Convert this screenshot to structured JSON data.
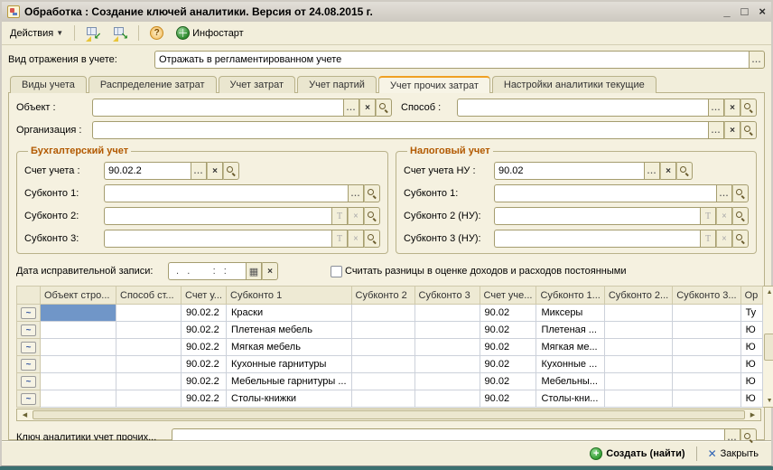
{
  "window": {
    "title": "Обработка : Создание ключей аналитики. Версия от 24.08.2015 г.",
    "controls": {
      "minimize": "_",
      "maximize": "□",
      "close": "×"
    }
  },
  "toolbar": {
    "actions": "Действия",
    "help": "?",
    "infostart": "Инфостарт"
  },
  "reflection": {
    "label": "Вид отражения в учете:",
    "value": "Отражать в регламентированном учете"
  },
  "tabs": [
    {
      "label": "Виды учета",
      "active": false
    },
    {
      "label": "Распределение затрат",
      "active": false
    },
    {
      "label": "Учет затрат",
      "active": false
    },
    {
      "label": "Учет партий",
      "active": false
    },
    {
      "label": "Учет прочих затрат",
      "active": true
    },
    {
      "label": "Настройки аналитики текущие",
      "active": false
    }
  ],
  "fields": {
    "object": {
      "label": "Объект :",
      "value": ""
    },
    "sposob": {
      "label": "Способ :",
      "value": ""
    },
    "organization": {
      "label": "Организация :",
      "value": ""
    }
  },
  "accounting_group": {
    "title": "Бухгалтерский учет",
    "account": {
      "label": "Счет учета :",
      "value": "90.02.2"
    },
    "sub1": {
      "label": "Субконто 1:",
      "value": ""
    },
    "sub2": {
      "label": "Субконто 2:",
      "value": ""
    },
    "sub3": {
      "label": "Субконто 3:",
      "value": ""
    }
  },
  "tax_group": {
    "title": "Налоговый учет",
    "account": {
      "label": "Счет учета НУ :",
      "value": "90.02"
    },
    "sub1": {
      "label": "Субконто 1:",
      "value": ""
    },
    "sub2": {
      "label": "Субконто 2 (НУ):",
      "value": ""
    },
    "sub3": {
      "label": "Субконто 3 (НУ):",
      "value": ""
    }
  },
  "correction": {
    "date_label": "Дата исправительной записи:",
    "date_value": " .  .      :  :",
    "checkbox_label": "Считать разницы в оценке доходов и расходов постоянными",
    "checkbox_checked": false
  },
  "table": {
    "columns": [
      "",
      "Объект стро...",
      "Способ ст...",
      "Счет у...",
      "Субконто 1",
      "Субконто 2",
      "Субконто 3",
      "Счет уче...",
      "Субконто 1...",
      "Субконто 2...",
      "Субконто 3...",
      "Ор"
    ],
    "rows": [
      [
        "",
        "",
        "90.02.2",
        "Краски",
        "",
        "",
        "90.02",
        "Миксеры",
        "",
        "",
        "Ту"
      ],
      [
        "",
        "",
        "90.02.2",
        "Плетеная мебель",
        "",
        "",
        "90.02",
        "Плетеная ...",
        "",
        "",
        "Ю"
      ],
      [
        "",
        "",
        "90.02.2",
        "Мягкая мебель",
        "",
        "",
        "90.02",
        "Мягкая ме...",
        "",
        "",
        "Ю"
      ],
      [
        "",
        "",
        "90.02.2",
        "Кухонные гарнитуры",
        "",
        "",
        "90.02",
        "Кухонные ...",
        "",
        "",
        "Ю"
      ],
      [
        "",
        "",
        "90.02.2",
        "Мебельные гарнитуры ...",
        "",
        "",
        "90.02",
        "Мебельны...",
        "",
        "",
        "Ю"
      ],
      [
        "",
        "",
        "90.02.2",
        "Столы-книжки",
        "",
        "",
        "90.02",
        "Столы-кни...",
        "",
        "",
        "Ю"
      ]
    ],
    "selected_cell": {
      "row": 0,
      "col": 1
    }
  },
  "analytics_key": {
    "label": "Ключ аналитики учет прочих...",
    "value": ""
  },
  "footer": {
    "create": "Создать (найти)",
    "close": "Закрыть"
  },
  "colors": {
    "accent_orange": "#b25900",
    "selection_blue": "#7096c8",
    "tab_active_edge": "#efa023",
    "create_green": "#2f9a2f",
    "close_blue": "#2f63b5",
    "client_bg": "#f2eedb"
  }
}
